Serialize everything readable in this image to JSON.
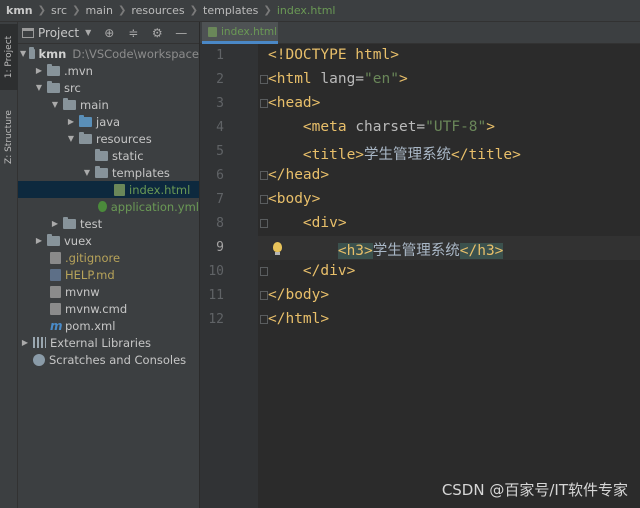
{
  "breadcrumb": [
    "kmn",
    "src",
    "main",
    "resources",
    "templates",
    "index.html"
  ],
  "toolstrip": {
    "project_tab": "1: Project",
    "structure_tab": "Z: Structure"
  },
  "project_panel": {
    "title": "Project",
    "tree": [
      {
        "label": "kmn",
        "path": "D:\\VSCode\\workspace",
        "kind": "folder"
      },
      {
        "label": ".mvn",
        "kind": "folder"
      },
      {
        "label": "src",
        "kind": "folder"
      },
      {
        "label": "main",
        "kind": "folder"
      },
      {
        "label": "java",
        "kind": "folder-blue"
      },
      {
        "label": "resources",
        "kind": "folder"
      },
      {
        "label": "static",
        "kind": "folder"
      },
      {
        "label": "templates",
        "kind": "folder"
      },
      {
        "label": "index.html",
        "kind": "file-html"
      },
      {
        "label": "application.yml",
        "kind": "file-yml"
      },
      {
        "label": "test",
        "kind": "folder"
      },
      {
        "label": "vuex",
        "kind": "folder"
      },
      {
        "label": ".gitignore",
        "kind": "file"
      },
      {
        "label": "HELP.md",
        "kind": "file"
      },
      {
        "label": "mvnw",
        "kind": "file"
      },
      {
        "label": "mvnw.cmd",
        "kind": "file"
      },
      {
        "label": "pom.xml",
        "kind": "file"
      },
      {
        "label": "External Libraries",
        "kind": "lib"
      },
      {
        "label": "Scratches and Consoles",
        "kind": "scratch"
      }
    ]
  },
  "editor": {
    "tab_label": "index.html",
    "line_numbers": [
      "1",
      "2",
      "3",
      "4",
      "5",
      "6",
      "7",
      "8",
      "9",
      "10",
      "11",
      "12"
    ],
    "current_line": "9",
    "lines": {
      "l1": "<!DOCTYPE html>",
      "l2_open": "<html ",
      "l2_attr": "lang=",
      "l2_val": "\"en\"",
      "l2_close": ">",
      "l3": "<head>",
      "l4_open": "<meta ",
      "l4_attr": "charset=",
      "l4_val": "\"UTF-8\"",
      "l4_close": ">",
      "l5_open": "<title>",
      "l5_text": "学生管理系统",
      "l5_close": "</title>",
      "l6": "</head>",
      "l7": "<body>",
      "l8": "<div>",
      "l9_open": "<h3>",
      "l9_text": "学生管理系统",
      "l9_close": "</h3>",
      "l10": "</div>",
      "l11": "</body>",
      "l12": "</html>"
    }
  },
  "watermark": "CSDN @百家号/IT软件专家",
  "colors": {
    "tag": "#e8bf6a",
    "string": "#6a8759",
    "accent": "#4a88c7",
    "selection": "#0d293e"
  }
}
